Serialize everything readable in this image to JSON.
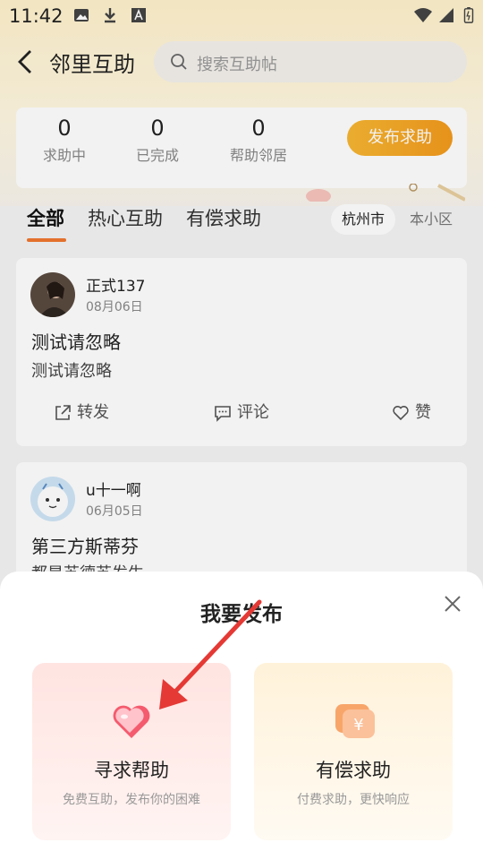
{
  "status_bar": {
    "time": "11:42"
  },
  "header": {
    "back_icon": "back-arrow-icon",
    "title": "邻里互助",
    "search": {
      "placeholder": "搜索互助帖",
      "icon": "search-icon"
    }
  },
  "stats": {
    "items": [
      {
        "value": "0",
        "label": "求助中"
      },
      {
        "value": "0",
        "label": "已完成"
      },
      {
        "value": "0",
        "label": "帮助邻居"
      }
    ],
    "publish_label": "发布求助"
  },
  "tabs": {
    "items": [
      "全部",
      "热心互助",
      "有偿求助"
    ],
    "active": "全部"
  },
  "filters": {
    "items": [
      "杭州市",
      "本小区"
    ],
    "selected": "杭州市"
  },
  "posts": [
    {
      "user": "正式137",
      "date": "08月06日",
      "title": "测试请忽略",
      "body": "测试请忽略",
      "actions": [
        "转发",
        "评论",
        "赞"
      ]
    },
    {
      "user": "u十一啊",
      "date": "06月05日",
      "title": "第三方斯蒂芬",
      "body": "都是苏德苏发生"
    }
  ],
  "sheet": {
    "title": "我要发布",
    "close_icon": "close-icon",
    "options": [
      {
        "title": "寻求帮助",
        "subtitle": "免费互助，发布你的困难",
        "icon": "heart-icon"
      },
      {
        "title": "有偿求助",
        "subtitle": "付费求助，更快响应",
        "icon": "coin-icon"
      }
    ]
  },
  "colors": {
    "accent": "#f0772f",
    "publish_button": "#f7b733",
    "pointer_arrow": "#e53935"
  }
}
